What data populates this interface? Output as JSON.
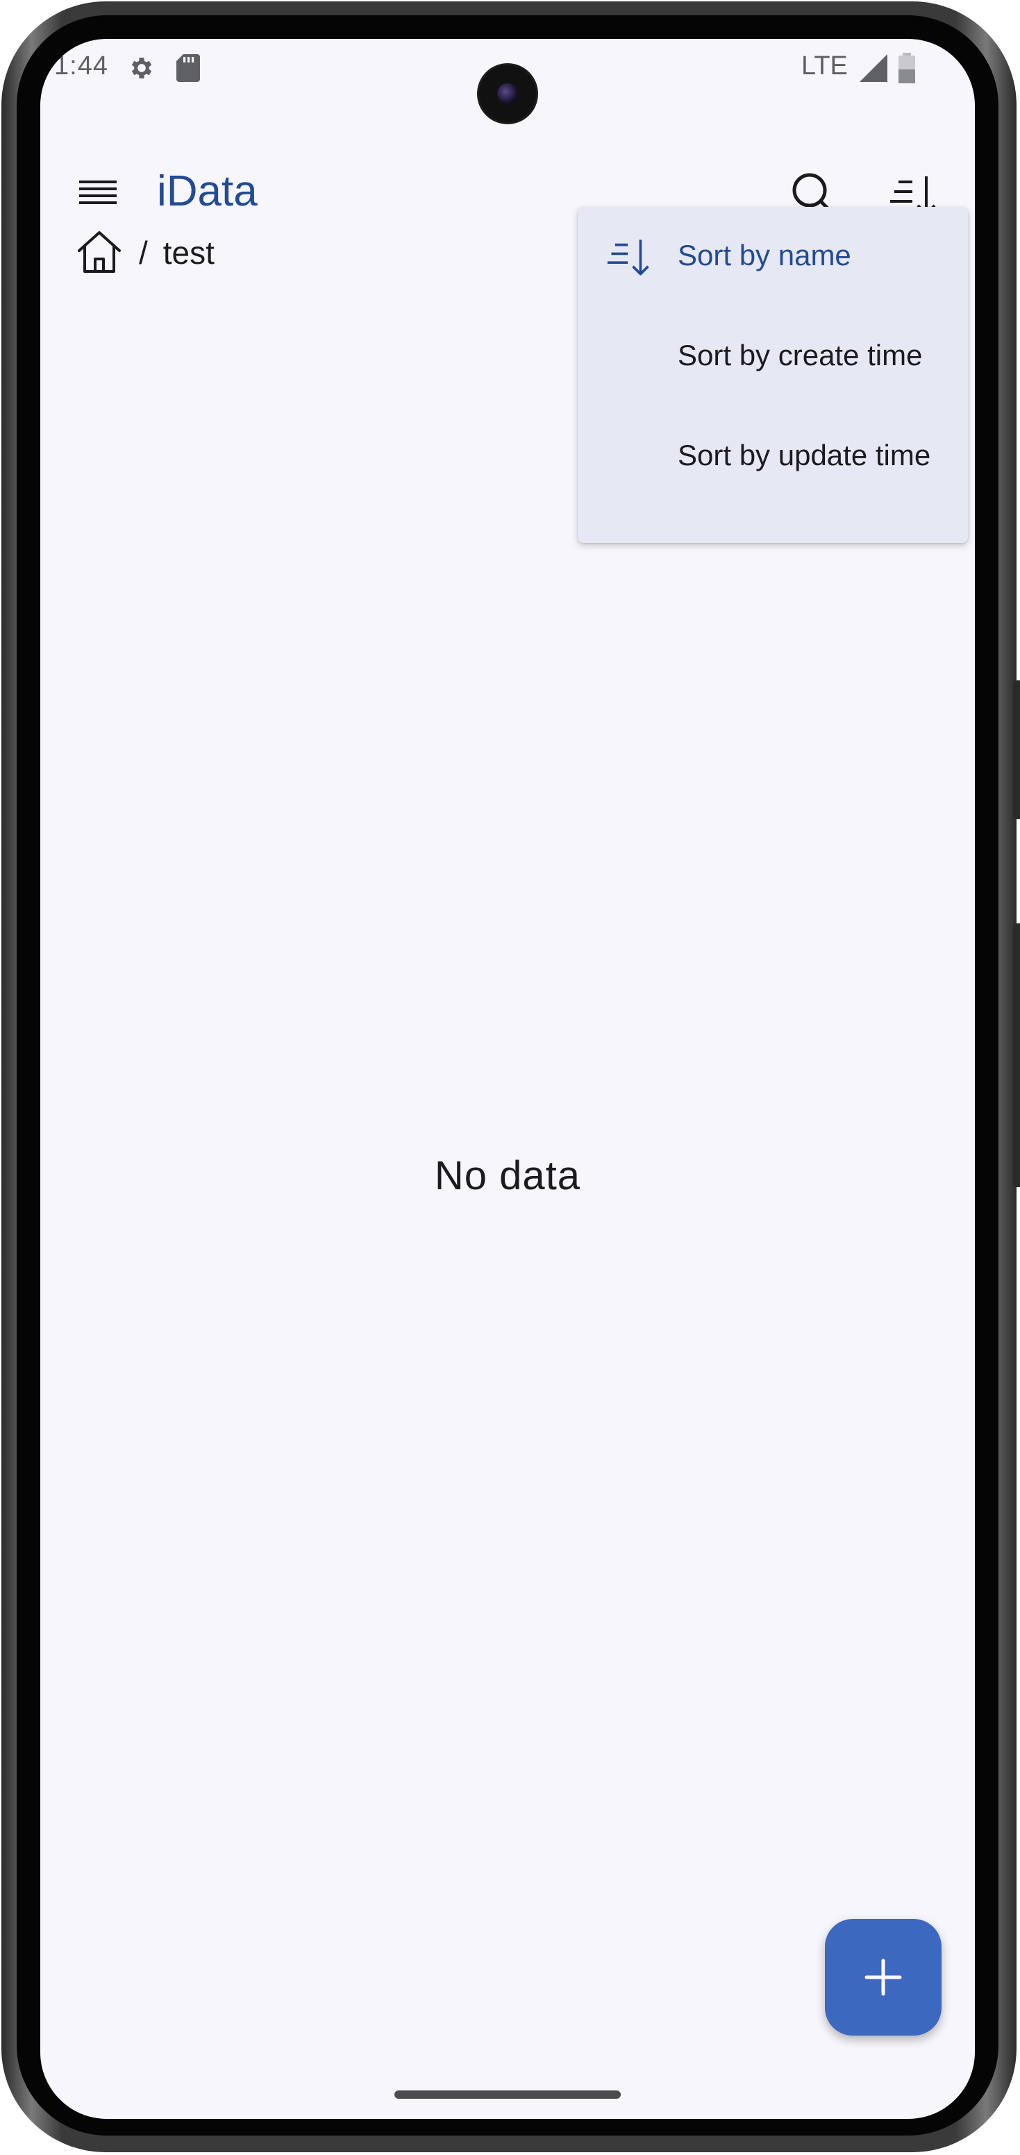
{
  "status_bar": {
    "time": "1:44",
    "network": "LTE",
    "icons": [
      "settings-icon",
      "sd-card-icon",
      "signal-icon",
      "battery-icon"
    ]
  },
  "app_bar": {
    "title": "iData",
    "title_color": "#234b94",
    "icons": [
      "menu-icon",
      "search-icon",
      "sort-icon"
    ]
  },
  "breadcrumb": {
    "home_icon": "home-icon",
    "separator": "/",
    "items": [
      "test"
    ]
  },
  "content": {
    "empty_message": "No data"
  },
  "sort_menu": {
    "items": [
      {
        "label": "Sort by name",
        "selected": true,
        "icon": "sort-icon"
      },
      {
        "label": "Sort by create time",
        "selected": false
      },
      {
        "label": "Sort by update time",
        "selected": false
      }
    ],
    "background": "#e6e8f3"
  },
  "fab": {
    "icon": "plus-icon",
    "color": "#3d68c0"
  }
}
